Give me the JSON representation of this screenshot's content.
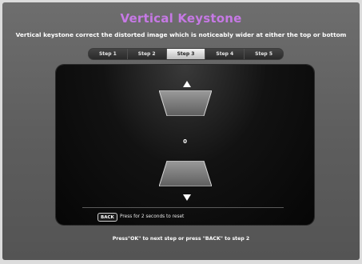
{
  "header": {
    "title": "Vertical Keystone",
    "subtitle": "Vertical keystone correct the distorted image which is noticeably wider at either the top or bottom"
  },
  "steps": [
    {
      "label": "Step 1",
      "active": false
    },
    {
      "label": "Step 2",
      "active": false
    },
    {
      "label": "Step 3",
      "active": true
    },
    {
      "label": "Step 4",
      "active": false
    },
    {
      "label": "Step 5",
      "active": false
    }
  ],
  "adjustment": {
    "value": "0",
    "up_arrow_icon": "triangle-up-icon",
    "down_arrow_icon": "triangle-down-icon"
  },
  "reset_hint": {
    "key_label": "BACK",
    "text": "Press for 2 seconds to reset"
  },
  "footer": {
    "text": "Press\"OK\" to next step or press \"BACK\" to step 2"
  },
  "colors": {
    "title": "#c679e5",
    "background": "#5e5e5e",
    "panel": "#060606",
    "active_step": "#e0e0e0"
  }
}
